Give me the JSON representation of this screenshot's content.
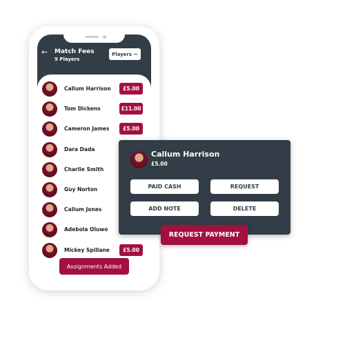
{
  "header": {
    "title": "Match Fees",
    "subtitle": "9 Players",
    "players_button": "Players",
    "back_icon": "arrow-left-icon",
    "edit_icon": "pencil-icon"
  },
  "players": [
    {
      "name": "Callum Harrison",
      "amount": "£5.00"
    },
    {
      "name": "Tom Dickens",
      "amount": "£11.00"
    },
    {
      "name": "Cameron James",
      "amount": "£5.00"
    },
    {
      "name": "Dara Dada",
      "amount": ""
    },
    {
      "name": "Charlie Smith",
      "amount": ""
    },
    {
      "name": "Guy Norton",
      "amount": ""
    },
    {
      "name": "Callum Jones",
      "amount": ""
    },
    {
      "name": "Adebola Oluwo",
      "amount": ""
    },
    {
      "name": "Mickey Spillane",
      "amount": "£5.00"
    }
  ],
  "assignments_button": "Assignments Added",
  "popup": {
    "name": "Callum Harrison",
    "amount": "£5.00",
    "paid_cash": "PAID CASH",
    "request": "REQUEST",
    "add_note": "ADD NOTE",
    "delete": "DELETE",
    "request_payment": "REQUEST PAYMENT"
  },
  "colors": {
    "accent": "#a3103f",
    "dark": "#323d47"
  }
}
